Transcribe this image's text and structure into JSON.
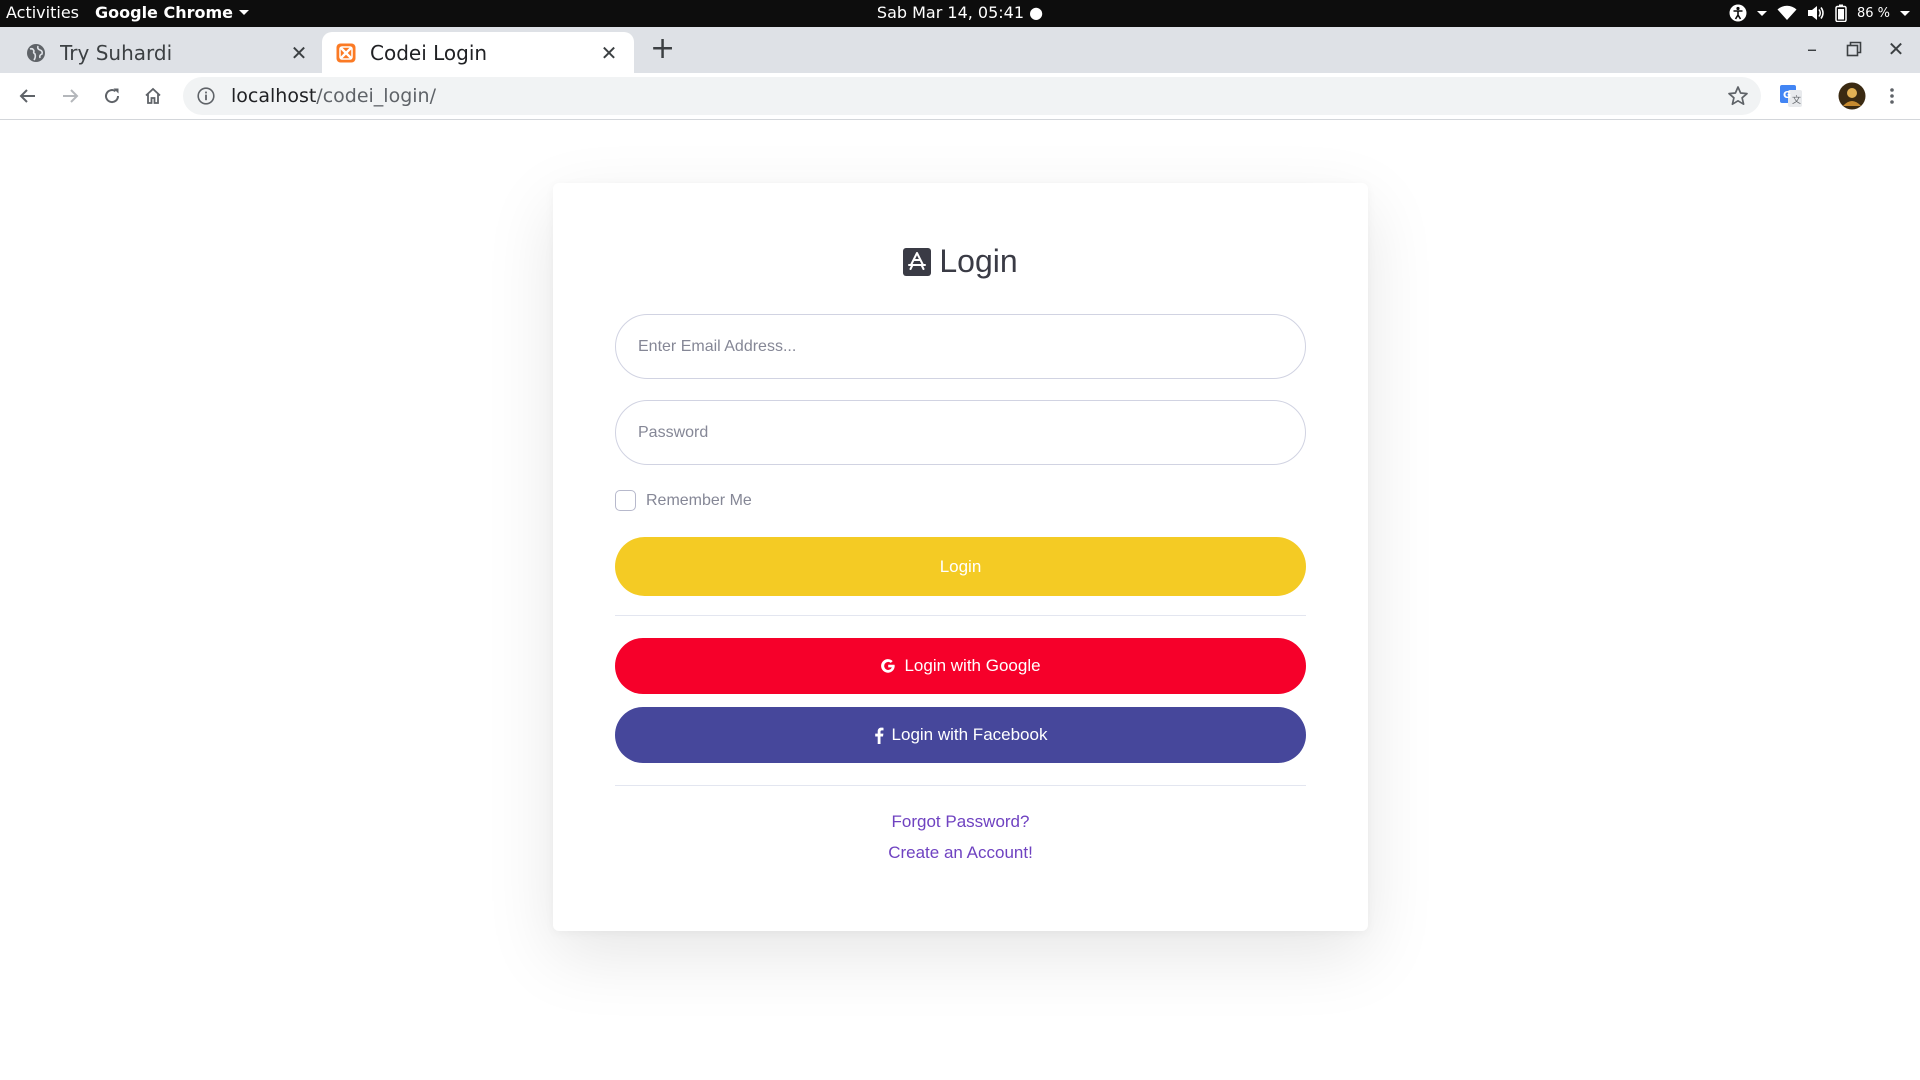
{
  "system_bar": {
    "activities": "Activities",
    "app_name": "Google Chrome",
    "datetime": "Sab Mar 14, 05:41",
    "battery": "86 %"
  },
  "browser": {
    "tabs": [
      {
        "title": "Try Suhardi",
        "active": false,
        "icon": "globe-icon"
      },
      {
        "title": "Codei Login",
        "active": true,
        "icon": "xampp-icon"
      }
    ],
    "url_host": "localhost",
    "url_path": "/codei_login/"
  },
  "login": {
    "title": "Login",
    "title_icon": "app-store-icon",
    "email_placeholder": "Enter Email Address...",
    "password_placeholder": "Password",
    "remember_label": "Remember Me",
    "login_button": "Login",
    "google_button": "Login with Google",
    "facebook_button": "Login with Facebook",
    "forgot_link": "Forgot Password?",
    "create_link": "Create an Account!"
  },
  "colors": {
    "login_button": "#f4cb24",
    "google_button": "#f6002a",
    "facebook_button": "#46479b",
    "link": "#6f42c1"
  }
}
